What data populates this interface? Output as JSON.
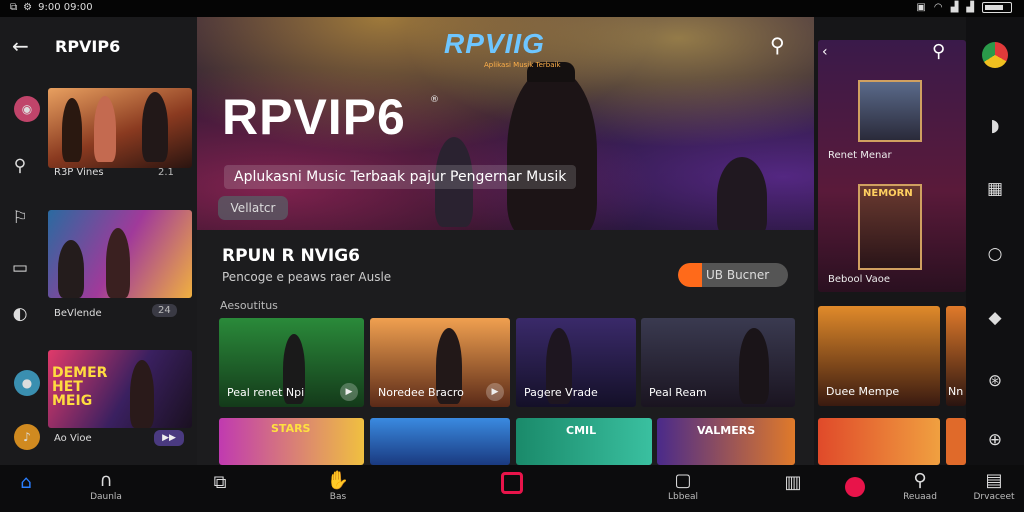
{
  "status_bar": {
    "time": "9:00 09:00"
  },
  "header": {
    "title": "RPVIP6"
  },
  "left_cards": [
    {
      "caption": "R3P Vines",
      "badge": "2.1"
    },
    {
      "caption": "BeVlende",
      "badge": "24"
    },
    {
      "caption": "Ao Vioe",
      "badge": "",
      "art_text": "DEMER HET MEIG"
    }
  ],
  "hero": {
    "logo": "RPVIIG",
    "logo_tag": "Aplikasi Musik Terbaik",
    "title": "RPVIP6",
    "subtitle": "Aplukasni Music Terbaak pajur Pengernar Musik",
    "button": "Vellatcr"
  },
  "section": {
    "title": "RPUN R NVIG6",
    "subtitle": "Pencoge e peaws raer Ausle",
    "button": "UB Bucner",
    "label": "Aesoutitus"
  },
  "tiles": [
    {
      "caption": "Peal renet Npi"
    },
    {
      "caption": "Noredee Bracro"
    },
    {
      "caption": "Pagere Vrade"
    },
    {
      "caption": "Peal Ream"
    }
  ],
  "tiles_row2_text": [
    "STARS",
    "CMIL",
    "VALMERS"
  ],
  "right_panel": {
    "card1_caption": "Renet Menar",
    "card2_caption": "Bebool Vaoe",
    "card2_art": "NEMORN",
    "tile_caption": "Duee Mempe",
    "tile2_caption": "Nn"
  },
  "bottom_nav": {
    "left_label": "Daunla",
    "items": [
      "Bas",
      "Lbbeal",
      "Reuaad",
      "Drvaceet"
    ]
  },
  "colors": {
    "accent": "#ff6a1a",
    "record": "#e8144a",
    "home": "#2a7fff"
  }
}
